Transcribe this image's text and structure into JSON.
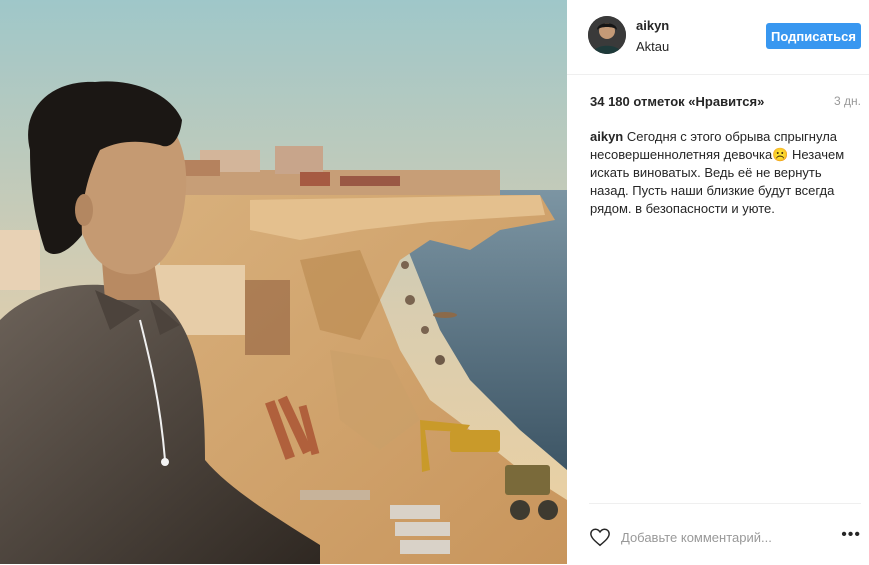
{
  "post": {
    "username": "aikyn",
    "location": "Aktau",
    "follow_label": "Подписаться",
    "likes": "34 180 отметок «Нравится»",
    "time": "3 дн.",
    "caption_user": "aikyn",
    "caption_text": " Сегодня с этого обрыва спрыгнула несовершеннолетняя девочка☹️ Незачем искать виноватых. Ведь её не вернуть назад. Пусть наши близкие будут всегда рядом. в безопасности и уюте."
  },
  "comment": {
    "placeholder": "Добавьте комментарий..."
  },
  "icons": {
    "like": "heart-icon",
    "more": "more-options-icon"
  },
  "colors": {
    "accent": "#3897f0",
    "text": "#262626",
    "muted": "#999999",
    "divider": "#efefef"
  }
}
